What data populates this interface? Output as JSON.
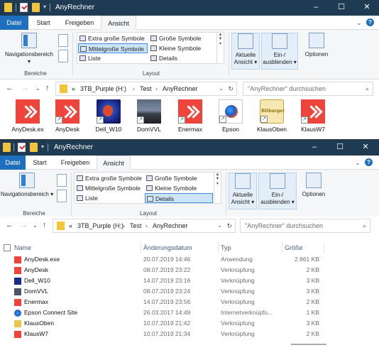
{
  "window_title": "AnyRechner",
  "tabs": [
    "Datei",
    "Start",
    "Freigeben",
    "Ansicht"
  ],
  "ribbon": {
    "nav_pane_label": "Navigationsbereich",
    "group_bereiche": "Bereiche",
    "group_layout": "Layout",
    "layout_options": [
      "Extra große Symbole",
      "Große Symbole",
      "Mittelgroße Symbole",
      "Kleine Symbole",
      "Liste",
      "Details"
    ],
    "current_view_line1": "Aktuelle",
    "current_view_line2": "Ansicht",
    "show_hide_line1": "Ein-/",
    "show_hide_line2": "ausblenden",
    "options_label": "Optionen"
  },
  "address": {
    "prefix": "«",
    "segments": [
      "3TB_Purple (H:)",
      "Test",
      "AnyRechner"
    ],
    "search_placeholder": "\"AnyRechner\" durchsuchen"
  },
  "icon_view": {
    "selected_layout": "Mittelgroße Symbole",
    "items": [
      {
        "label": "AnyDesk.ex",
        "icon": "anydesk-icon"
      },
      {
        "label": "AnyDesk",
        "icon": "anydesk-icon"
      },
      {
        "label": "Dell_W10",
        "icon": "dell-icon"
      },
      {
        "label": "DomVVL",
        "icon": "landscape-icon"
      },
      {
        "label": "Enermax",
        "icon": "anydesk-icon"
      },
      {
        "label": "Epson",
        "icon": "epson-icon"
      },
      {
        "label": "KlausOben",
        "icon": "bitburger-icon"
      },
      {
        "label": "KlausW7",
        "icon": "anydesk-icon"
      }
    ]
  },
  "details_view": {
    "selected_layout": "Details",
    "columns": [
      "Name",
      "Änderungsdatum",
      "Typ",
      "Größe"
    ],
    "rows": [
      {
        "name": "AnyDesk.exe",
        "date": "20.07.2019 14:46",
        "type": "Anwendung",
        "size": "2.861 KB",
        "icon": "red"
      },
      {
        "name": "AnyDesk",
        "date": "08.07.2019 23:22",
        "type": "Verknüpfung",
        "size": "2 KB",
        "icon": "red"
      },
      {
        "name": "Dell_W10",
        "date": "14.07.2019 23:16",
        "type": "Verknüpfung",
        "size": "3 KB",
        "icon": "dell"
      },
      {
        "name": "DomVVL",
        "date": "08.07.2019 23:24",
        "type": "Verknüpfung",
        "size": "3 KB",
        "icon": "dom"
      },
      {
        "name": "Enermax",
        "date": "14.07.2019 23:56",
        "type": "Verknüpfung",
        "size": "2 KB",
        "icon": "red"
      },
      {
        "name": "Epson Connect Site",
        "date": "26.03.2017 14:49",
        "type": "Internetverknüpfu...",
        "size": "1 KB",
        "icon": "epson"
      },
      {
        "name": "KlausOben",
        "date": "10.07.2019 21:42",
        "type": "Verknüpfung",
        "size": "3 KB",
        "icon": "beer"
      },
      {
        "name": "KlausW7",
        "date": "10.07.2019 21:34",
        "type": "Verknüpfung",
        "size": "2 KB",
        "icon": "red"
      }
    ]
  },
  "colors": {
    "titlebar": "#1e3b53",
    "file_tab": "#1e6fbd",
    "selection": "#cce4f7",
    "anydesk_red": "#ef443b"
  }
}
